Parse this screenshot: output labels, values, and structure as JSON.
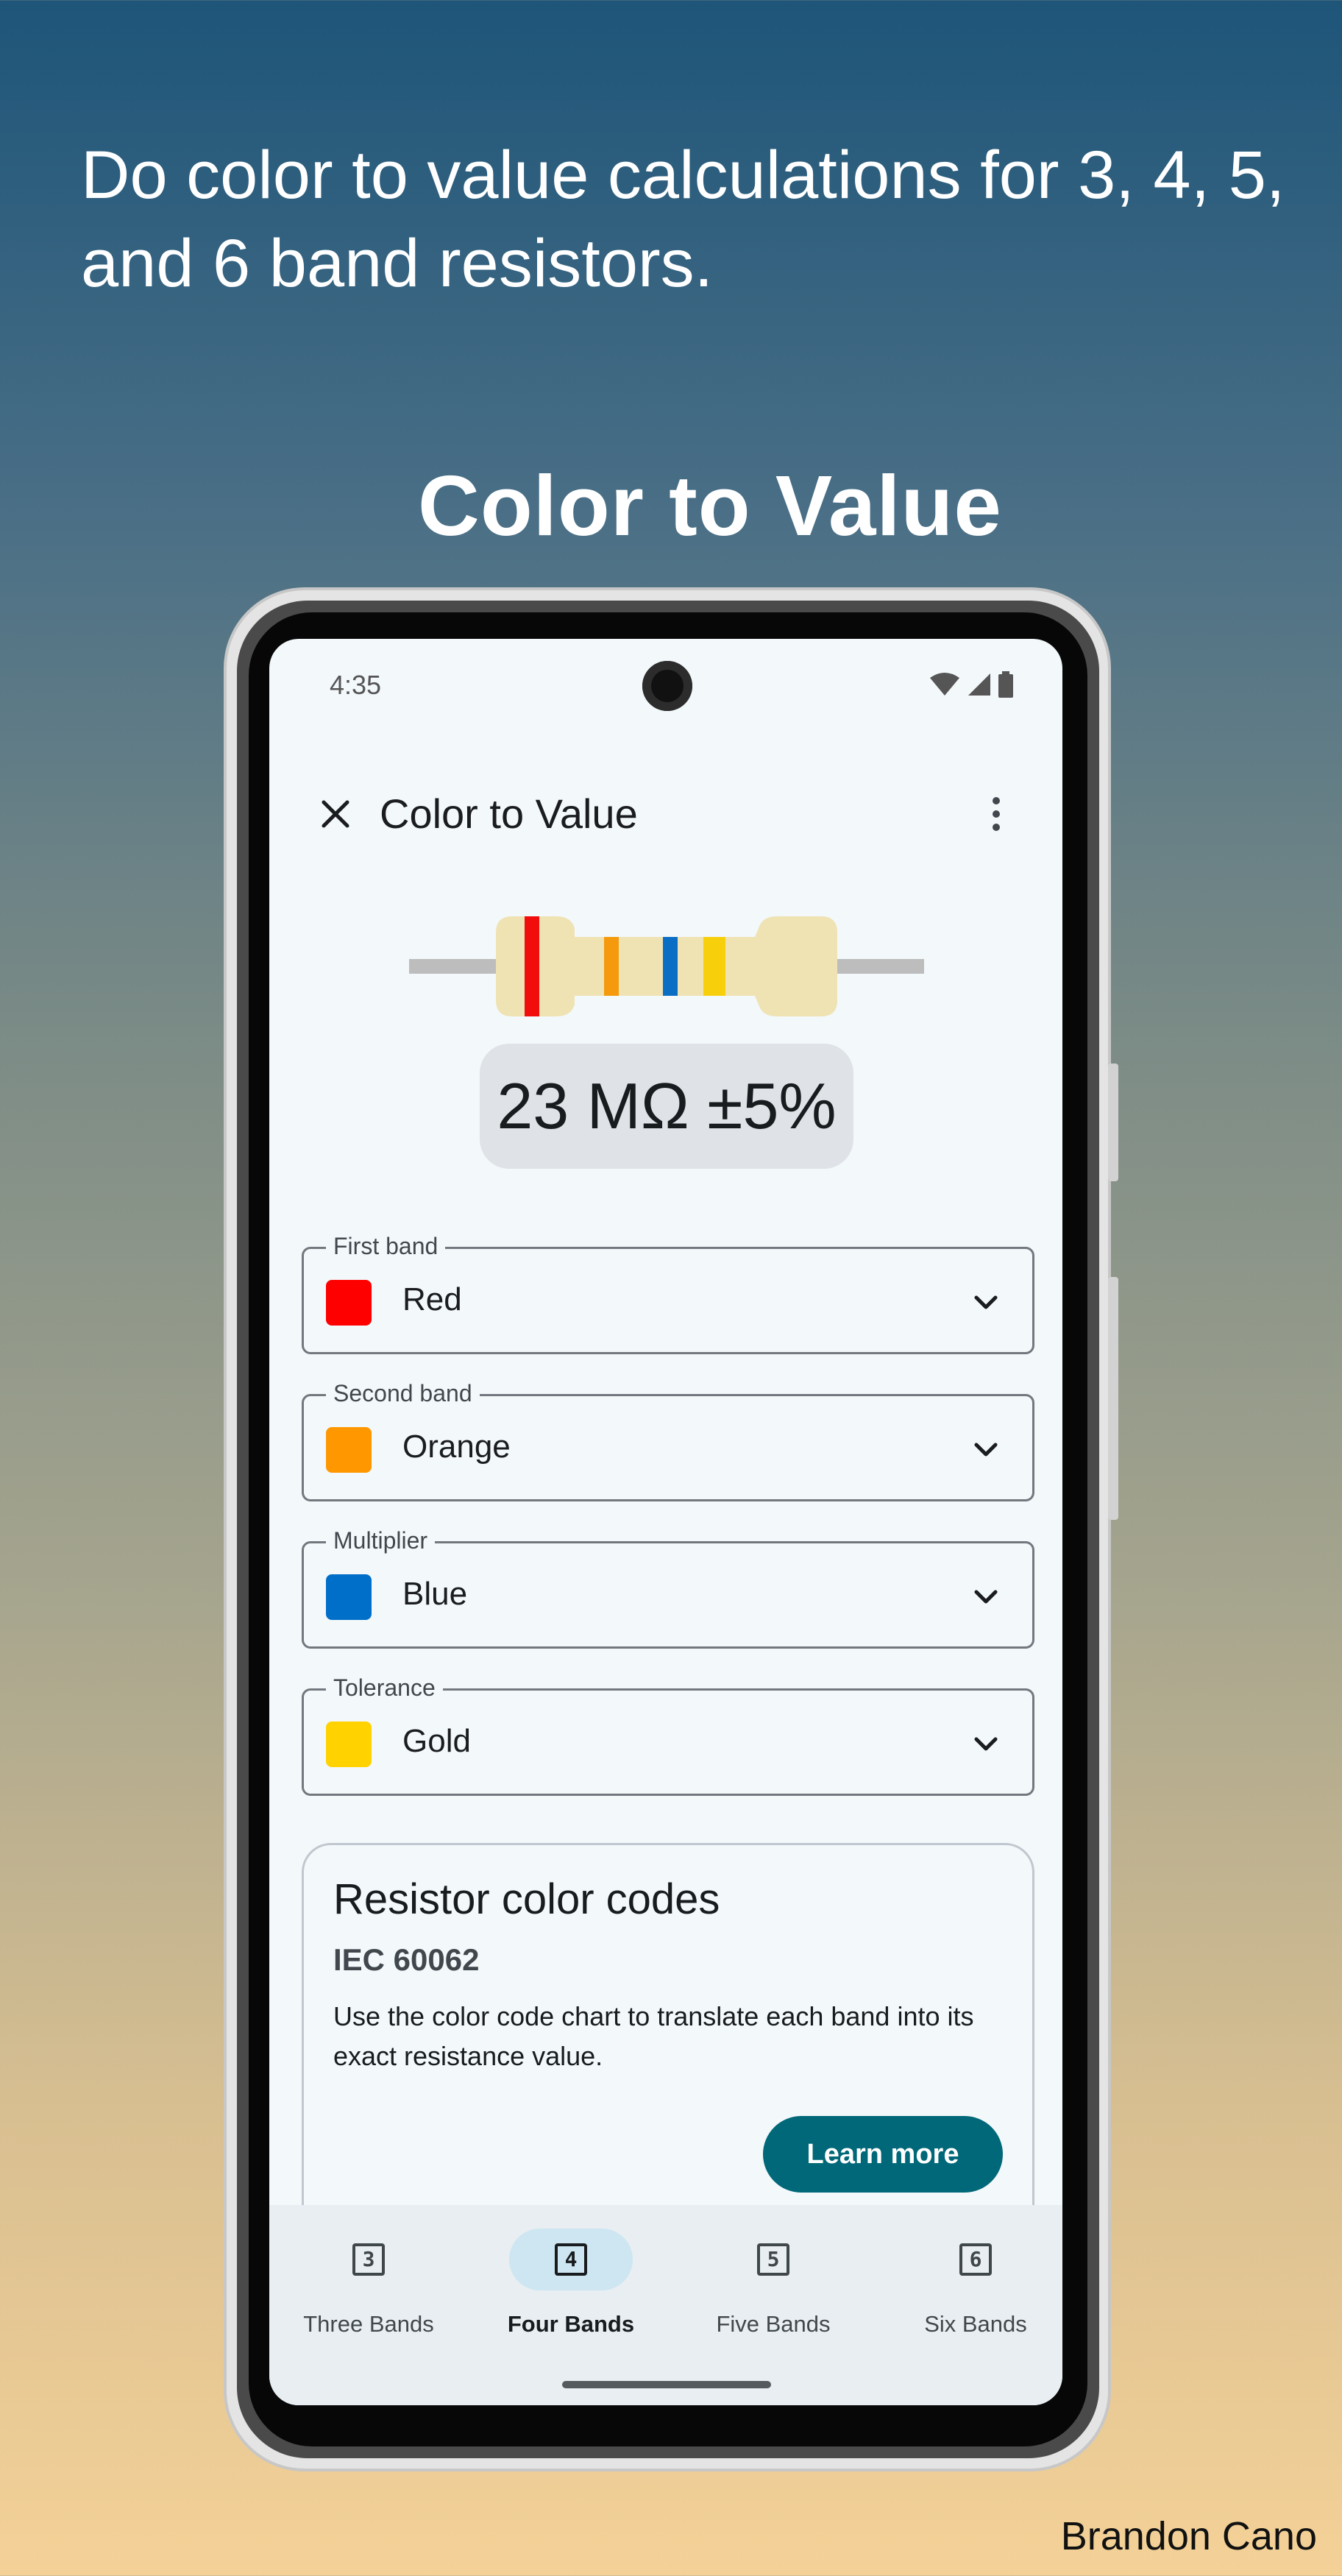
{
  "promo": {
    "caption": "Do color to value calculations for 3, 4, 5, and 6 band resistors.",
    "heading": "Color to Value",
    "author": "Brandon Cano"
  },
  "status_bar": {
    "time": "4:35",
    "icons": [
      "wifi-icon",
      "signal-icon",
      "battery-icon"
    ]
  },
  "app_bar": {
    "title": "Color to Value",
    "close_icon": "close-icon",
    "menu_icon": "more-vert-icon"
  },
  "resistor": {
    "body_color": "#efe3b4",
    "lead_color": "#bdbdbd",
    "bands": [
      "#f20d0d",
      "#f59a0c",
      "#0a6fc4",
      "#f7cf0a"
    ]
  },
  "result": {
    "value": "23 MΩ ±5%"
  },
  "fields": [
    {
      "label": "First band",
      "value": "Red",
      "color": "#ff0000"
    },
    {
      "label": "Second band",
      "value": "Orange",
      "color": "#ff9800"
    },
    {
      "label": "Multiplier",
      "value": "Blue",
      "color": "#006fc9"
    },
    {
      "label": "Tolerance",
      "value": "Gold",
      "color": "#ffd200"
    }
  ],
  "info_card": {
    "title": "Resistor color codes",
    "subtitle": "IEC 60062",
    "body": "Use the color code chart to translate each band into its exact resistance value.",
    "button": "Learn more"
  },
  "nav": {
    "items": [
      {
        "number": "3",
        "label": "Three Bands",
        "active": false
      },
      {
        "number": "4",
        "label": "Four Bands",
        "active": true
      },
      {
        "number": "5",
        "label": "Five Bands",
        "active": false
      },
      {
        "number": "6",
        "label": "Six Bands",
        "active": false
      }
    ]
  },
  "colors": {
    "accent": "#006878",
    "active_nav_pill": "#cde6f1",
    "screen_background": "#f3f8fb"
  }
}
